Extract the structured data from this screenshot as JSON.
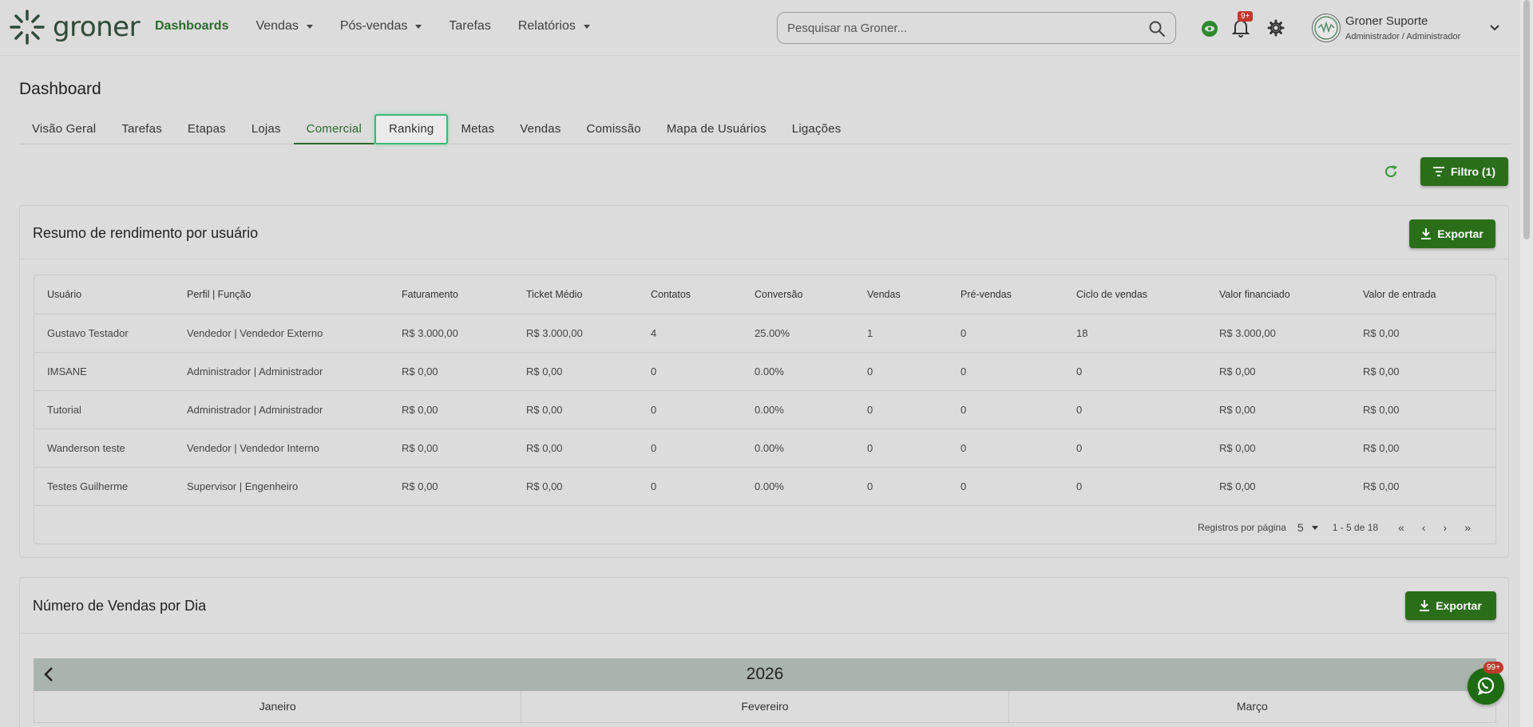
{
  "app": {
    "logo_text": "groner",
    "logo_icon": "burst-icon",
    "brand_color": "#2d6a2d",
    "accent_color": "#2a6e1a"
  },
  "nav": {
    "items": [
      {
        "label": "Dashboards",
        "active": true,
        "has_caret": false
      },
      {
        "label": "Vendas",
        "has_caret": true
      },
      {
        "label": "Pós-vendas",
        "has_caret": true
      },
      {
        "label": "Tarefas",
        "has_caret": false
      },
      {
        "label": "Relatórios",
        "has_caret": true
      }
    ]
  },
  "search": {
    "placeholder": "Pesquisar na Groner...",
    "value": ""
  },
  "header": {
    "notifications_badge": "9+",
    "user_name": "Groner Suporte",
    "user_role": "Administrador / Administrador"
  },
  "page": {
    "title": "Dashboard",
    "tabs": [
      {
        "label": "Visão Geral"
      },
      {
        "label": "Tarefas"
      },
      {
        "label": "Etapas"
      },
      {
        "label": "Lojas"
      },
      {
        "label": "Comercial",
        "active": true
      },
      {
        "label": "Ranking",
        "focused": true
      },
      {
        "label": "Metas"
      },
      {
        "label": "Vendas"
      },
      {
        "label": "Comissão"
      },
      {
        "label": "Mapa de Usuários"
      },
      {
        "label": "Ligações"
      }
    ],
    "filter_label": "Filtro (1)"
  },
  "summary": {
    "title": "Resumo de rendimento por usuário",
    "export_label": "Exportar",
    "columns": [
      "Usuário",
      "Perfil | Função",
      "Faturamento",
      "Ticket Médio",
      "Contatos",
      "Conversão",
      "Vendas",
      "Pré-vendas",
      "Ciclo de vendas",
      "Valor financiado",
      "Valor de entrada"
    ],
    "rows": [
      [
        "Gustavo Testador",
        "Vendedor | Vendedor Externo",
        "R$ 3.000,00",
        "R$ 3.000,00",
        "4",
        "25.00%",
        "1",
        "0",
        "18",
        "R$ 3.000,00",
        "R$ 0,00"
      ],
      [
        "IMSANE",
        "Administrador | Administrador",
        "R$ 0,00",
        "R$ 0,00",
        "0",
        "0.00%",
        "0",
        "0",
        "0",
        "R$ 0,00",
        "R$ 0,00"
      ],
      [
        "Tutorial",
        "Administrador | Administrador",
        "R$ 0,00",
        "R$ 0,00",
        "0",
        "0.00%",
        "0",
        "0",
        "0",
        "R$ 0,00",
        "R$ 0,00"
      ],
      [
        "Wanderson teste",
        "Vendedor | Vendedor Interno",
        "R$ 0,00",
        "R$ 0,00",
        "0",
        "0.00%",
        "0",
        "0",
        "0",
        "R$ 0,00",
        "R$ 0,00"
      ],
      [
        "Testes Guilherme",
        "Supervisor | Engenheiro",
        "R$ 0,00",
        "R$ 0,00",
        "0",
        "0.00%",
        "0",
        "0",
        "0",
        "R$ 0,00",
        "R$ 0,00"
      ]
    ],
    "pagination": {
      "per_page_label": "Registros por página",
      "per_page_value": "5",
      "range": "1 - 5 de 18",
      "first": "«",
      "prev": "‹",
      "next": "›",
      "last": "»"
    }
  },
  "sales_per_day": {
    "title": "Número de Vendas por Dia",
    "export_label": "Exportar",
    "year": "2026",
    "months": [
      "Janeiro",
      "Fevereiro",
      "Março"
    ]
  },
  "chat": {
    "badge": "99+",
    "icon": "whatsapp-icon"
  }
}
